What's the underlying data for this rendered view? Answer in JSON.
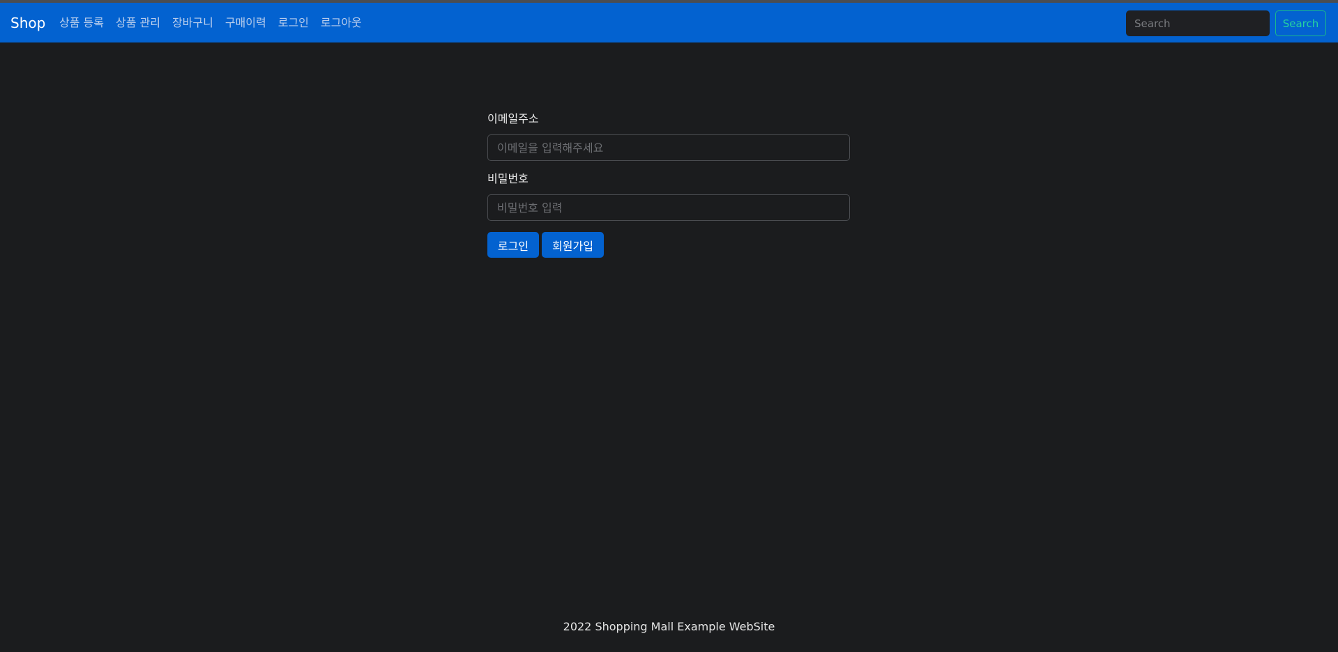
{
  "navbar": {
    "brand": "Shop",
    "links": [
      "상품 등록",
      "상품 관리",
      "장바구니",
      "구매이력",
      "로그인",
      "로그아웃"
    ],
    "search": {
      "placeholder": "Search",
      "button_label": "Search"
    }
  },
  "login_form": {
    "email_label": "이메일주소",
    "email_placeholder": "이메일을 입력해주세요",
    "password_label": "비밀번호",
    "password_placeholder": "비밀번호 입력",
    "login_button": "로그인",
    "signup_button": "회원가입"
  },
  "footer": {
    "text": "2022 Shopping Mall Example WebSite"
  },
  "colors": {
    "navbar": "#0362d0",
    "background": "#1b1c1e",
    "search_accent": "#1ab98a"
  }
}
